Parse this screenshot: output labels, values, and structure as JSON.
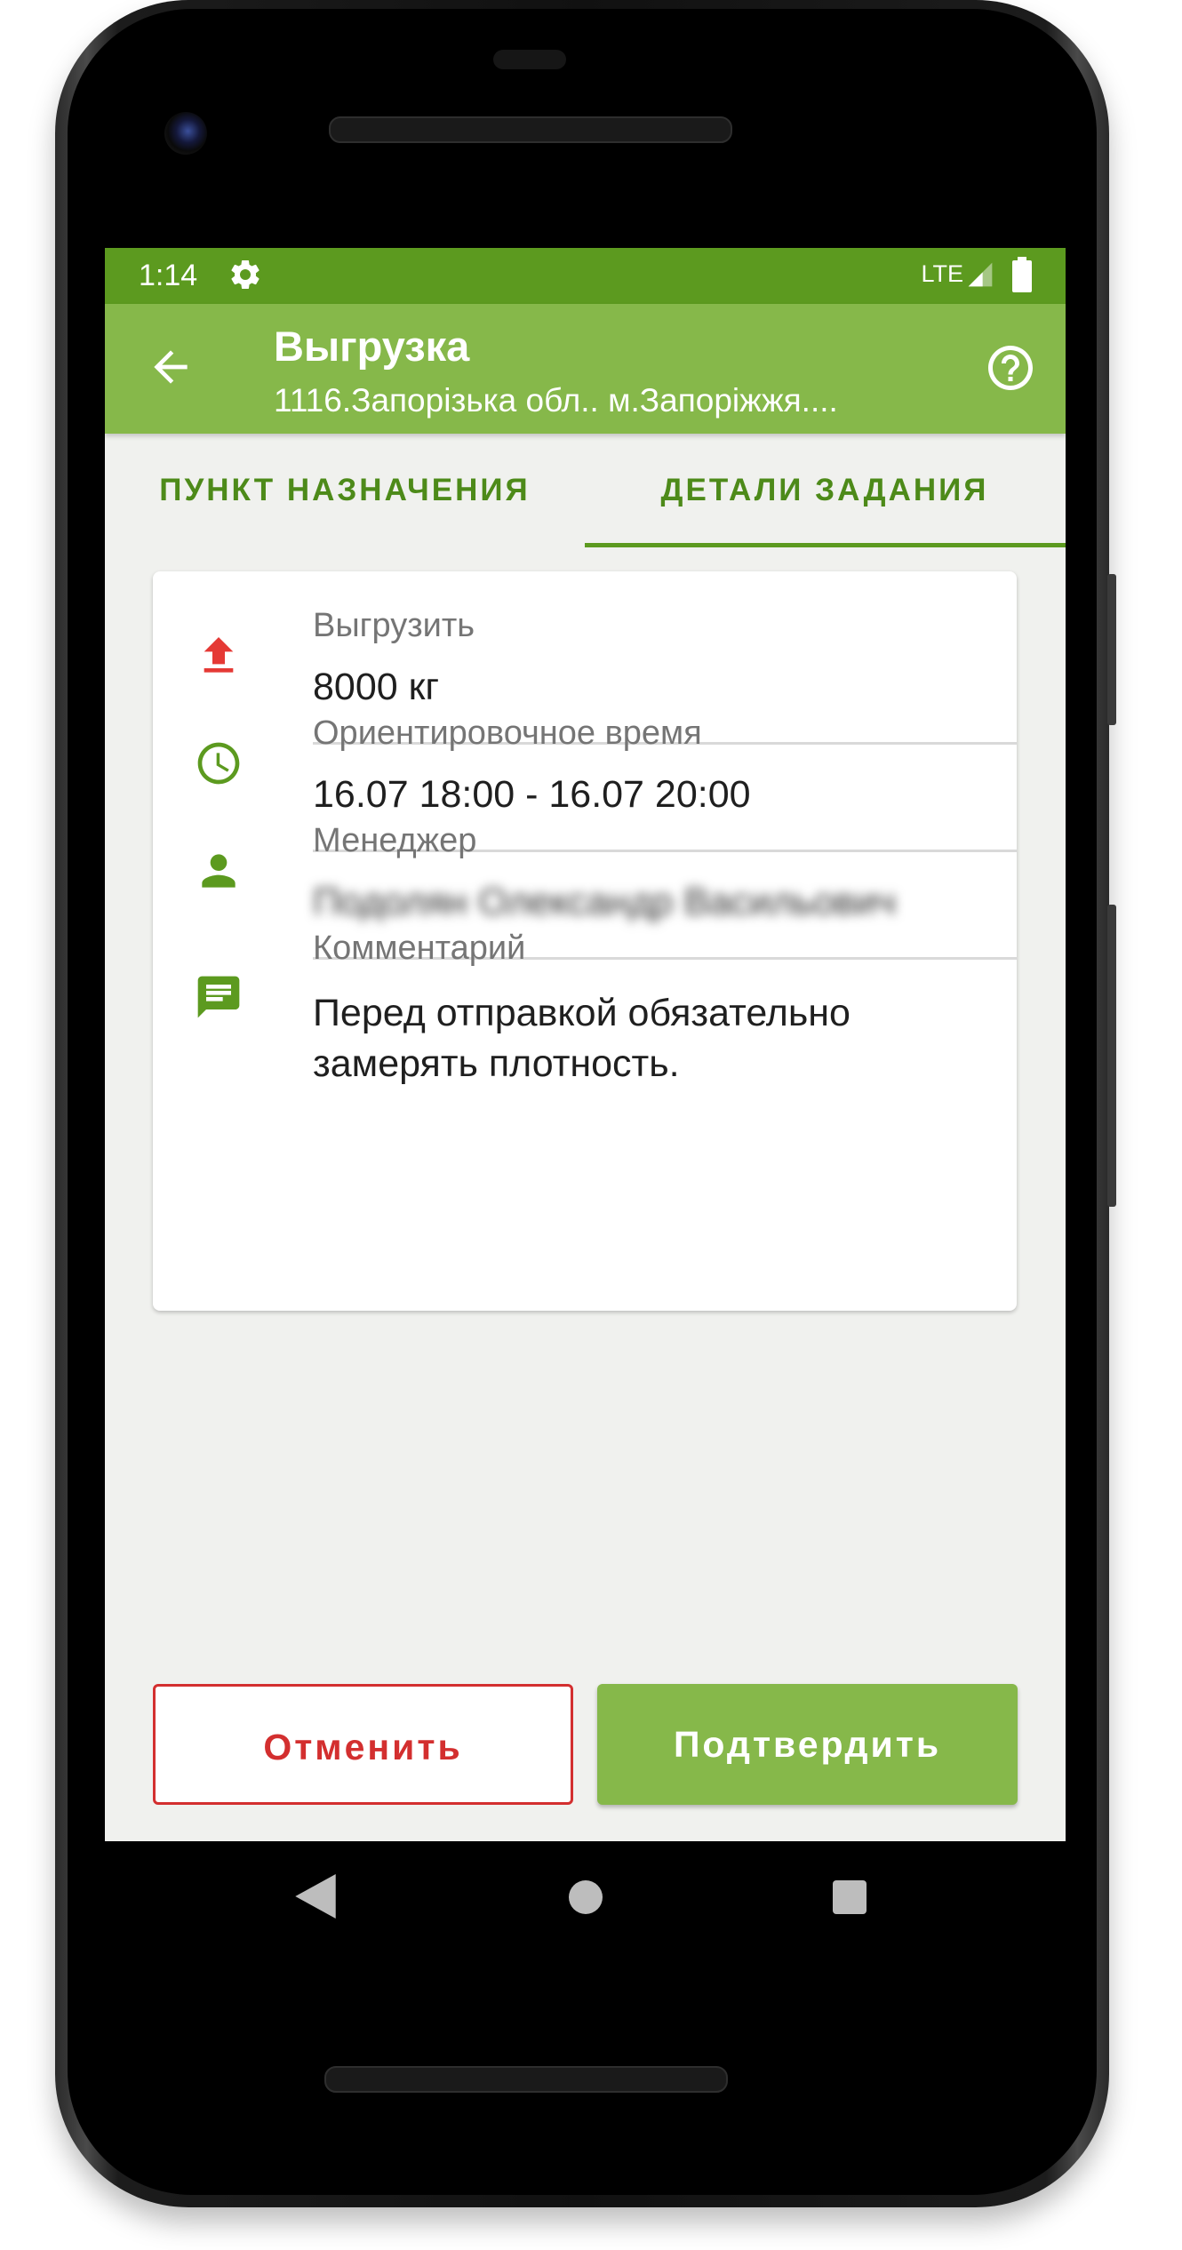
{
  "status_bar": {
    "time": "1:14",
    "network": "LTE",
    "color": "#5c9a1f"
  },
  "app_bar": {
    "title": "Выгрузка",
    "subtitle": "1116.Запорізька обл.. м.Запоріжжя....",
    "back_icon": "arrow-back-icon",
    "help_icon": "help-circle-icon",
    "color": "#86b84a"
  },
  "tabs": [
    {
      "label": "ПУНКТ НАЗНАЧЕНИЯ",
      "selected": false
    },
    {
      "label": "ДЕТАЛИ ЗАДАНИЯ",
      "selected": true
    }
  ],
  "details": {
    "unload": {
      "label": "Выгрузить",
      "value": "8000 кг",
      "icon": "upload-icon",
      "icon_color": "#e53935"
    },
    "time": {
      "label": "Ориентировочное время",
      "value": "16.07 18:00 - 16.07 20:00",
      "icon": "clock-icon",
      "icon_color": "#5c9a1f"
    },
    "manager": {
      "label": "Менеджер",
      "value": "Подолян Олександр Васильович",
      "icon": "person-icon",
      "icon_color": "#5c9a1f"
    },
    "comment": {
      "label": "Комментарий",
      "value": "Перед отправкой обязательно замерять плотность.",
      "icon": "comment-icon",
      "icon_color": "#5c9a1f"
    }
  },
  "actions": {
    "cancel_label": "Отменить",
    "confirm_label": "Подтвердить",
    "cancel_color": "#d32f2f",
    "confirm_color": "#86b84a"
  }
}
